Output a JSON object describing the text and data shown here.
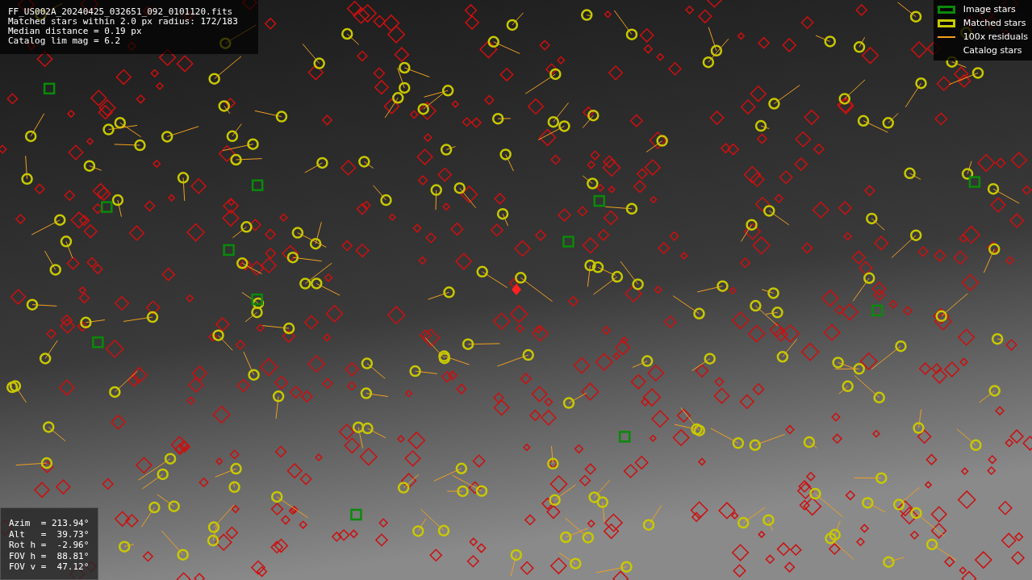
{
  "info_lines": [
    "FF_US002A_20240425_032651_092_0101120.fits",
    "Matched stars within 2.0 px radius: 172/183",
    "Median distance = 0.19 px",
    "Catalog lim mag = 6.2"
  ],
  "legend": [
    {
      "kind": "image",
      "label": "Image stars"
    },
    {
      "kind": "matched",
      "label": "Matched stars"
    },
    {
      "kind": "residual",
      "label": "100x residuals"
    },
    {
      "kind": "catalog",
      "label": "Catalog stars"
    }
  ],
  "pointing": [
    "Azim  = 213.94°",
    "Alt   =  39.73°",
    "Rot h =  -2.96°",
    "FOV h =  88.81°",
    "FOV v =  47.12°"
  ]
}
